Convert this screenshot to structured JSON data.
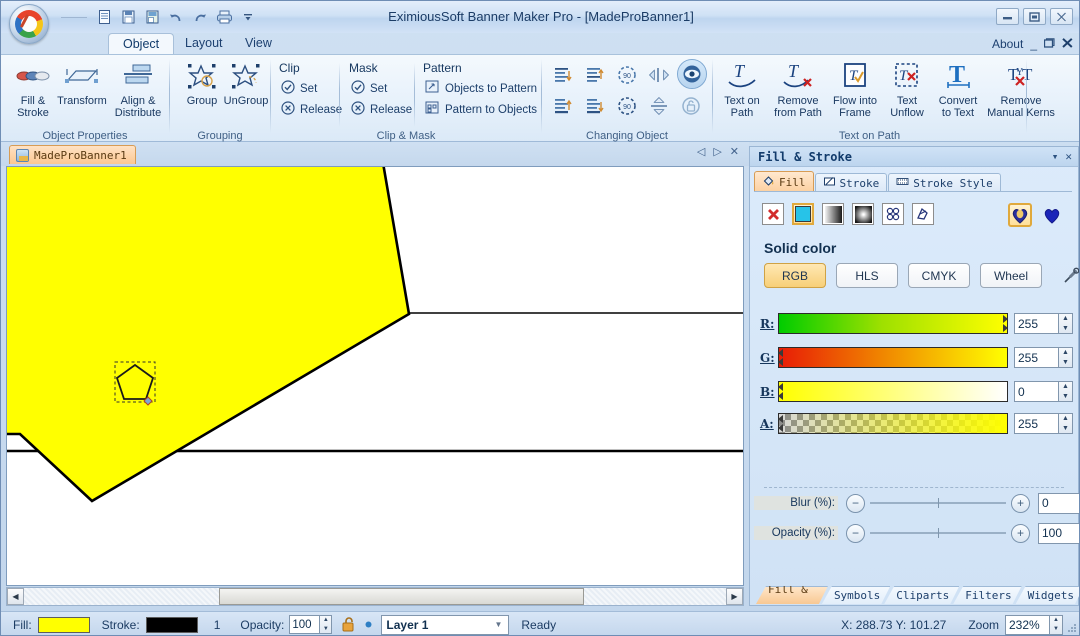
{
  "window": {
    "title": "EximiousSoft Banner Maker Pro - [MadeProBanner1]",
    "minimize": "—",
    "restore": "❐",
    "close": "✕",
    "about_label": "About",
    "about_min": "_",
    "about_restore": "❐",
    "about_close": "✕"
  },
  "quick_access": [
    {
      "name": "new-document-icon",
      "glyph": "🗋"
    },
    {
      "name": "save-icon",
      "glyph": "🖫"
    },
    {
      "name": "save-as-icon",
      "glyph": "🖬"
    },
    {
      "name": "undo-icon",
      "glyph": "↺"
    },
    {
      "name": "redo-icon",
      "glyph": "↻"
    },
    {
      "name": "print-icon",
      "glyph": "🖶"
    },
    {
      "name": "customize-qat-icon",
      "glyph": "▾"
    }
  ],
  "ribbon_tabs": [
    {
      "label": "Object",
      "active": true
    },
    {
      "label": "Layout",
      "active": false
    },
    {
      "label": "View",
      "active": false
    }
  ],
  "ribbon": {
    "object_properties": {
      "label": "Object Properties",
      "buttons": [
        {
          "label": "Fill &\nStroke",
          "line1": "Fill &",
          "line2": "Stroke",
          "icon": "fill-stroke-icon"
        },
        {
          "label": "Transform",
          "line1": "Transform",
          "line2": "",
          "icon": "transform-icon"
        },
        {
          "label": "Align &\nDistribute",
          "line1": "Align &",
          "line2": "Distribute",
          "icon": "align-distribute-icon"
        }
      ]
    },
    "grouping": {
      "label": "Grouping",
      "buttons": [
        {
          "line1": "Group",
          "line2": "",
          "icon": "group-icon"
        },
        {
          "line1": "UnGroup",
          "line2": "",
          "icon": "ungroup-icon"
        }
      ]
    },
    "clip_mask": {
      "label": "Clip & Mask",
      "clip": {
        "header": "Clip",
        "set": "Set",
        "release": "Release"
      },
      "mask": {
        "header": "Mask",
        "set": "Set",
        "release": "Release"
      },
      "pattern": {
        "header": "Pattern",
        "objects_to_pattern": "Objects to Pattern",
        "pattern_to_objects": "Pattern to Objects"
      }
    },
    "changing_object": {
      "label": "Changing Object",
      "icons": [
        "bring-forward-icon",
        "send-backward-icon",
        "rotate-right-90-icon",
        "flip-horizontal-icon",
        "show-hide-icon",
        "bring-to-front-icon",
        "send-to-back-icon",
        "rotate-left-90-icon",
        "flip-vertical-icon",
        "lock-unlock-icon"
      ]
    },
    "text_on_path": {
      "label": "Text on Path",
      "buttons": [
        {
          "line1": "Text on",
          "line2": "Path",
          "icon": "text-on-path-icon"
        },
        {
          "line1": "Remove",
          "line2": "from Path",
          "icon": "remove-from-path-icon"
        },
        {
          "line1": "Flow into",
          "line2": "Frame",
          "icon": "flow-into-frame-icon"
        },
        {
          "line1": "Text",
          "line2": "Unflow",
          "icon": "text-unflow-icon"
        },
        {
          "line1": "Convert",
          "line2": "to Text",
          "icon": "convert-to-text-icon"
        },
        {
          "line1": "Remove",
          "line2": "Manual Kerns",
          "icon": "remove-manual-kerns-icon"
        }
      ]
    }
  },
  "document": {
    "tab_label": "MadeProBanner1",
    "nav_prev": "◁",
    "nav_next": "▷",
    "nav_close": "✕"
  },
  "canvas": {
    "background": "#ffffff",
    "shape_fill": "#ffff00",
    "shape_stroke": "#000000",
    "selected_object": "pentagon"
  },
  "panel": {
    "title": "Fill & Stroke",
    "collapse": "▾",
    "close": "✕",
    "tabs": [
      {
        "label": "Fill",
        "icon": "fill-bucket-icon",
        "active": true
      },
      {
        "label": "Stroke",
        "icon": "stroke-pen-icon",
        "active": false
      },
      {
        "label": "Stroke Style",
        "icon": "stroke-style-icon",
        "active": false
      }
    ],
    "fill_types": [
      {
        "name": "no-fill-icon",
        "selected": false
      },
      {
        "name": "solid-fill-icon",
        "selected": true
      },
      {
        "name": "linear-gradient-icon",
        "selected": false
      },
      {
        "name": "radial-gradient-icon",
        "selected": false
      },
      {
        "name": "pattern-fill-icon",
        "selected": false
      },
      {
        "name": "swatch-fill-icon",
        "selected": false
      }
    ],
    "heart_buttons": [
      {
        "name": "fill-heart-selected-icon",
        "selected": true
      },
      {
        "name": "fill-heart-icon",
        "selected": false
      }
    ],
    "solid_color_label": "Solid color",
    "color_modes": [
      {
        "label": "RGB",
        "selected": true
      },
      {
        "label": "HLS",
        "selected": false
      },
      {
        "label": "CMYK",
        "selected": false
      },
      {
        "label": "Wheel",
        "selected": false
      }
    ],
    "eyedropper": "eyedropper-icon",
    "channels": [
      {
        "label": "R:",
        "value": "255"
      },
      {
        "label": "G:",
        "value": "255"
      },
      {
        "label": "B:",
        "value": "0"
      },
      {
        "label": "A:",
        "value": "255"
      }
    ],
    "blur": {
      "label": "Blur (%):",
      "value": "0",
      "minus": "−",
      "plus": "+"
    },
    "opacity": {
      "label": "Opacity (%):",
      "value": "100",
      "minus": "−",
      "plus": "+"
    },
    "bottom_tabs": [
      {
        "label": "Fill & ...",
        "active": true
      },
      {
        "label": "Symbols",
        "active": false
      },
      {
        "label": "Cliparts",
        "active": false
      },
      {
        "label": "Filters",
        "active": false
      },
      {
        "label": "Widgets",
        "active": false
      }
    ]
  },
  "statusbar": {
    "fill_label": "Fill:",
    "fill_color": "#ffff00",
    "stroke_label": "Stroke:",
    "stroke_color": "#000000",
    "stroke_width": "1",
    "opacity_label": "Opacity:",
    "opacity_value": "100",
    "lock_icon": "lock-open-icon",
    "layer_name": "Layer 1",
    "ready_text": "Ready",
    "coords": "X: 288.73 Y: 101.27",
    "zoom_label": "Zoom",
    "zoom_value": "232%"
  }
}
